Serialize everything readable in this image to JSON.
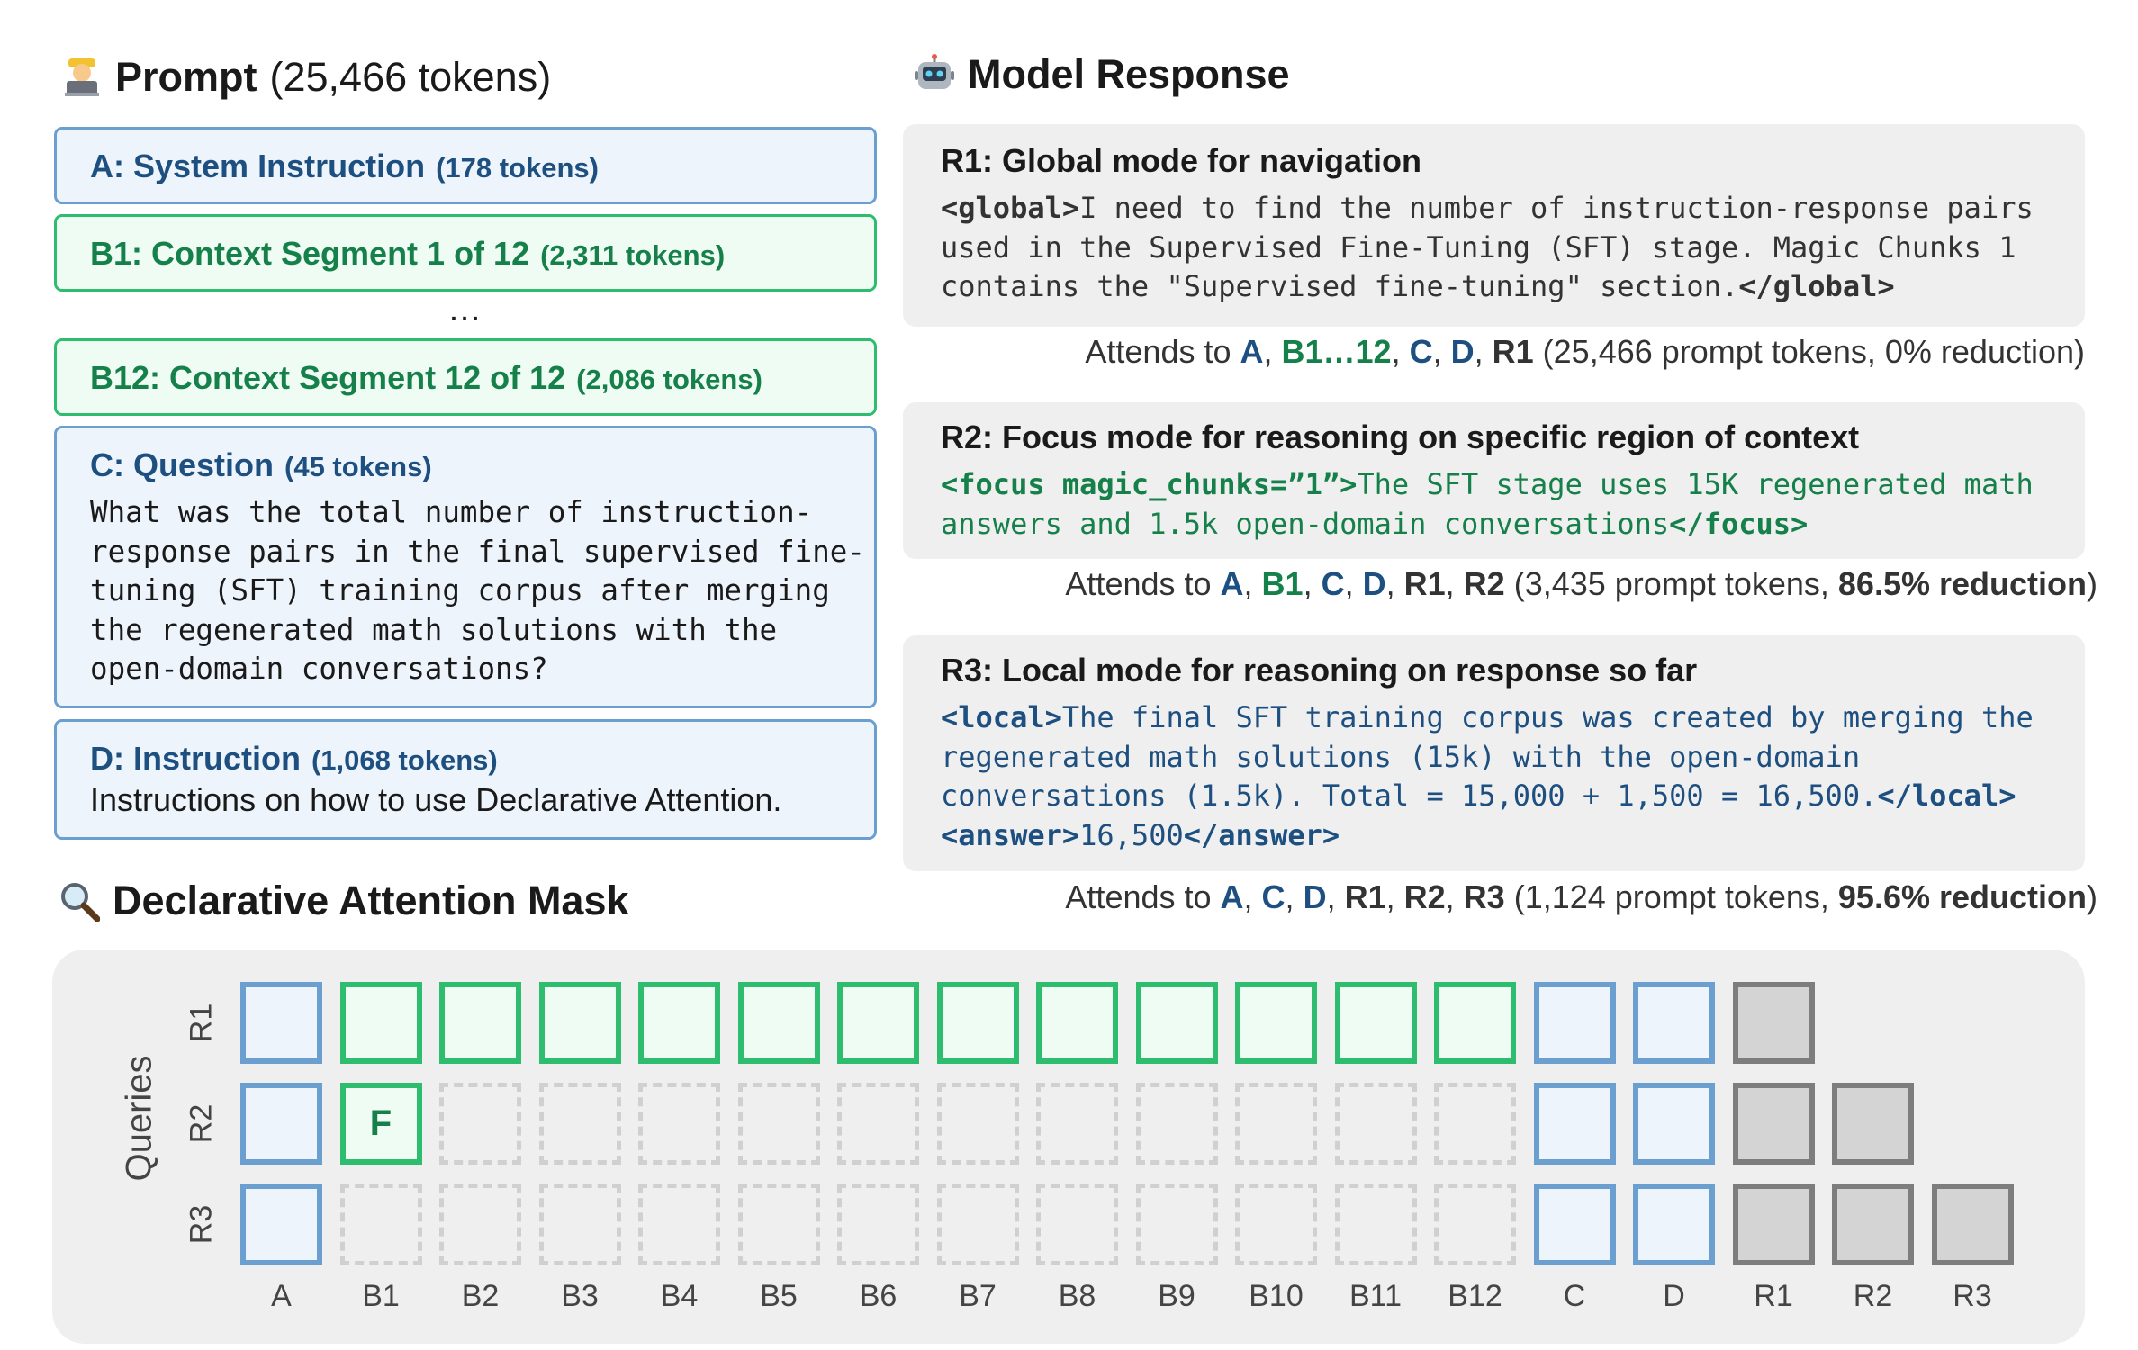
{
  "prompt": {
    "title": "Prompt",
    "subtitle": "(25,466 tokens)",
    "boxes": {
      "a": {
        "label": "A: System Instruction",
        "tokens": "(178 tokens)"
      },
      "b1": {
        "label": "B1: Context Segment 1 of 12",
        "tokens": "(2,311 tokens)"
      },
      "ellipsis": "…",
      "b12": {
        "label": "B12: Context Segment 12 of 12",
        "tokens": "(2,086 tokens)"
      },
      "c": {
        "label": "C: Question",
        "tokens": "(45 tokens)",
        "text": "What was the total number of instruction-\nresponse pairs in the final supervised fine-\ntuning (SFT) training corpus after merging\nthe regenerated math solutions with the\nopen-domain conversations?"
      },
      "d": {
        "label": "D: Instruction",
        "tokens": "(1,068 tokens)",
        "text": "Instructions on how to  use Declarative Attention."
      }
    }
  },
  "response": {
    "title": "Model Response",
    "r1": {
      "heading": "R1: Global mode for navigation",
      "open_tag": "<global>",
      "text": "I need to find the number of instruction-response pairs\nused in the Supervised Fine-Tuning (SFT) stage. Magic Chunks 1\ncontains the \"Supervised fine-tuning\" section.",
      "close_tag": "</global>",
      "attend_prefix": "Attends to ",
      "attend_targets": [
        "A",
        "B1…12",
        "C",
        "D",
        "R1"
      ],
      "attend_suffix": " (25,466 prompt tokens, 0% reduction)"
    },
    "r2": {
      "heading": "R2: Focus mode for reasoning on specific region of context",
      "open_tag": "<focus magic_chunks=”1”>",
      "text": "The SFT stage uses 15K regenerated math\nanswers and 1.5k open-domain conversations",
      "close_tag": "</focus>",
      "attend_prefix": "Attends to ",
      "attend_targets": [
        "A",
        "B1",
        "C",
        "D",
        "R1",
        "R2"
      ],
      "attend_suffix": " (3,435 prompt tokens, ",
      "attend_bold": "86.5% reduction",
      "attend_end": ")"
    },
    "r3": {
      "heading": "R3: Local mode for reasoning on response so far",
      "open_tag": "<local>",
      "text": "The final SFT training corpus was created by merging the\nregenerated math solutions (15k) with the open-domain\nconversations (1.5k). Total = 15,000 + 1,500 = 16,500.",
      "close_tag": "</local>",
      "answer_open": "<answer>",
      "answer_value": "16,500",
      "answer_close": "</answer>",
      "attend_prefix": "Attends to ",
      "attend_targets": [
        "A",
        "C",
        "D",
        "R1",
        "R2",
        "R3"
      ],
      "attend_suffix": " (1,124 prompt tokens, ",
      "attend_bold": "95.6% reduction",
      "attend_end": ")"
    }
  },
  "mask": {
    "title": "Declarative Attention Mask",
    "axis_label": "Queries",
    "rows": [
      "R1",
      "R2",
      "R3"
    ],
    "columns": [
      "A",
      "B1",
      "B2",
      "B3",
      "B4",
      "B5",
      "B6",
      "B7",
      "B8",
      "B9",
      "B10",
      "B11",
      "B12",
      "C",
      "D",
      "R1",
      "R2",
      "R3"
    ],
    "focus_mark": "F",
    "grid": [
      [
        "blue",
        "green",
        "green",
        "green",
        "green",
        "green",
        "green",
        "green",
        "green",
        "green",
        "green",
        "green",
        "green",
        "blue",
        "blue",
        "gray",
        "none",
        "none"
      ],
      [
        "blue",
        "focus",
        "empty",
        "empty",
        "empty",
        "empty",
        "empty",
        "empty",
        "empty",
        "empty",
        "empty",
        "empty",
        "empty",
        "blue",
        "blue",
        "gray",
        "gray",
        "none"
      ],
      [
        "blue",
        "empty",
        "empty",
        "empty",
        "empty",
        "empty",
        "empty",
        "empty",
        "empty",
        "empty",
        "empty",
        "empty",
        "empty",
        "blue",
        "blue",
        "gray",
        "gray",
        "gray"
      ]
    ]
  },
  "colors": {
    "blue_border": "#6b9fd0",
    "blue_fill": "#eef4fb",
    "blue_text": "#1d4f80",
    "green_border": "#2ebd6e",
    "green_fill": "#effcf4",
    "green_text": "#16804a",
    "gray_border": "#7d7d7d",
    "gray_fill": "#d4d4d4"
  },
  "icons": [
    "technologist-emoji-icon",
    "robot-emoji-icon",
    "magnifier-emoji-icon"
  ]
}
